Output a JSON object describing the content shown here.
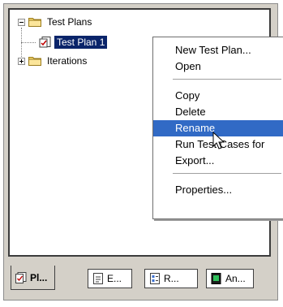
{
  "tree": {
    "items": [
      {
        "label": "Test Plans",
        "expanded": true
      },
      {
        "label": "Test Plan 1",
        "selected": true
      },
      {
        "label": "Iterations",
        "expanded": false
      }
    ]
  },
  "context_menu": {
    "items": [
      {
        "label": "New Test Plan..."
      },
      {
        "label": "Open"
      },
      {
        "label": "Copy"
      },
      {
        "label": "Delete"
      },
      {
        "label": "Rename",
        "highlighted": true
      },
      {
        "label": "Run Test Cases for"
      },
      {
        "label": "Export..."
      },
      {
        "label": "Properties..."
      }
    ]
  },
  "tabs": [
    {
      "label": "Pl...",
      "active": true,
      "icon": "plan-icon"
    },
    {
      "label": "E...",
      "icon": "document-icon"
    },
    {
      "label": "R...",
      "icon": "report-icon"
    },
    {
      "label": "An...",
      "icon": "analysis-icon"
    }
  ],
  "colors": {
    "selection": "#0a246a",
    "menu_highlight": "#316ac5",
    "panel": "#d4d0c8"
  }
}
